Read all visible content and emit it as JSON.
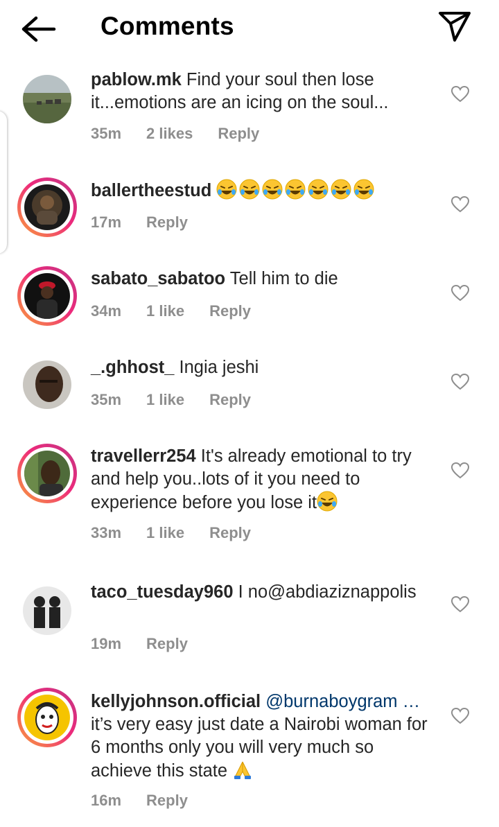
{
  "header": {
    "title": "Comments"
  },
  "comments": [
    {
      "user": "pablow.mk",
      "text": " Find your soul then lose it...emotions are an icing on the soul...",
      "time": "35m",
      "likes": "2 likes",
      "reply": "Reply"
    },
    {
      "user": "ballertheestud",
      "text": " ",
      "time": "17m",
      "likes": "",
      "reply": "Reply",
      "emoji_count": 7
    },
    {
      "user": "sabato_sabatoo",
      "text": " Tell him to die",
      "time": "34m",
      "likes": "1 like",
      "reply": "Reply"
    },
    {
      "user": "_.ghhost_",
      "text": " Ingia jeshi",
      "time": "35m",
      "likes": "1 like",
      "reply": "Reply"
    },
    {
      "user": "travellerr254",
      "text": " It's already emotional to try and help you..lots of it you need to experience before you lose it",
      "time": "33m",
      "likes": "1 like",
      "reply": "Reply"
    },
    {
      "user": "taco_tuesday960",
      "text": " I no@abdiaziznappolis",
      "time": "19m",
      "likes": "",
      "reply": "Reply"
    },
    {
      "user": "kellyjohnson.official",
      "mention": " @burnaboygram …",
      "text": " it’s very easy just date a Nairobi woman for 6 months only you will  very much so achieve this state ",
      "time": "16m",
      "likes": "",
      "reply": "Reply"
    }
  ]
}
